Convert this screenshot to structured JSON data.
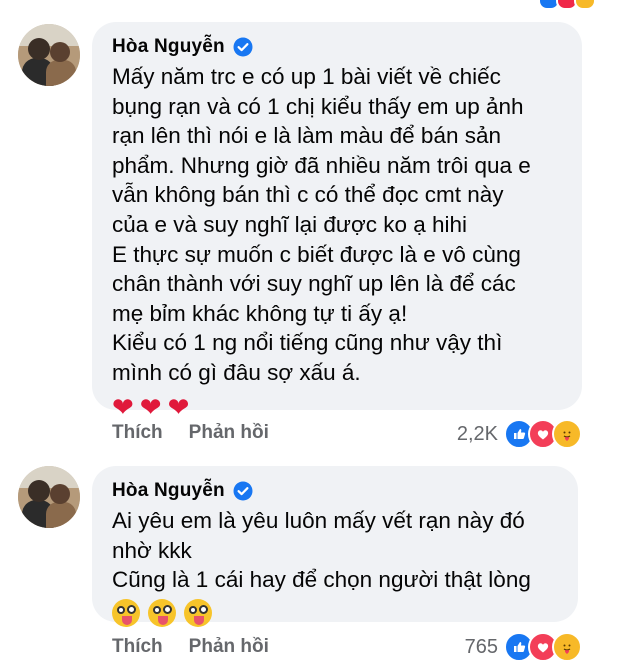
{
  "comments": [
    {
      "name": "Hòa Nguyễn",
      "lines": [
        "Mấy năm trc e có up 1 bài viết về chiếc",
        "bụng rạn và có 1 chị kiểu thấy em up ảnh",
        "rạn lên thì nói e là làm màu để bán sản",
        "phẩm. Nhưng giờ đã nhiều năm trôi qua e",
        "vẫn không bán thì c có thể đọc cmt này",
        "của e và suy nghĩ lại được ko ạ hihi",
        "E thực sự muốn c biết được là e vô cùng",
        "chân thành với suy nghĩ up lên là để các",
        "mẹ bỉm khác không tự ti ấy ạ!",
        "Kiểu có 1 ng nổi tiếng cũng như vậy thì",
        "mình có gì đâu sợ xấu á."
      ],
      "emoji": [
        "❤️",
        "❤️",
        "❤️"
      ],
      "like_label": "Thích",
      "reply_label": "Phản hồi",
      "reaction_count": "2,2K"
    },
    {
      "name": "Hòa Nguyễn",
      "lines": [
        "Ai yêu em là yêu luôn mấy vết rạn này đó",
        "nhờ kkk",
        "Cũng là 1 cái hay để chọn người thật lòng"
      ],
      "emoji": [
        "crazy-face",
        "crazy-face",
        "crazy-face"
      ],
      "like_label": "Thích",
      "reply_label": "Phản hồi",
      "reaction_count": "765"
    }
  ],
  "colors": {
    "bubble": "#f0f2f5",
    "secondary_text": "#65676b",
    "verified": "#1877f2",
    "like": "#1877f2",
    "love": "#f33e58",
    "care": "#f7b928"
  }
}
